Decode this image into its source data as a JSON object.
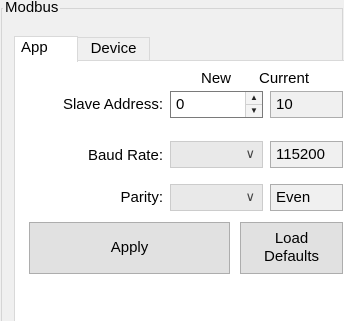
{
  "group": {
    "title": "Modbus"
  },
  "tabs": [
    {
      "label": "App",
      "selected": true
    },
    {
      "label": "Device",
      "selected": false
    }
  ],
  "columns": {
    "new": "New",
    "current": "Current"
  },
  "slave_address": {
    "label": "Slave Address:",
    "new_value": "0",
    "current_value": "10"
  },
  "baud_rate": {
    "label": "Baud Rate:",
    "new_value": "",
    "current_value": "115200"
  },
  "parity": {
    "label": "Parity:",
    "new_value": "",
    "current_value": "Even"
  },
  "buttons": {
    "apply": "Apply",
    "load_defaults_line1": "Load",
    "load_defaults_line2": "Defaults"
  },
  "icons": {
    "spin_up": "chevron-up-icon",
    "spin_down": "chevron-down-icon",
    "dropdown": "chevron-down-icon"
  },
  "colors": {
    "window_bg": "#f0f0f0",
    "tab_page_bg": "#ffffff",
    "button_bg": "#e1e1e1",
    "disabled_field_bg": "#e9e9e9"
  }
}
